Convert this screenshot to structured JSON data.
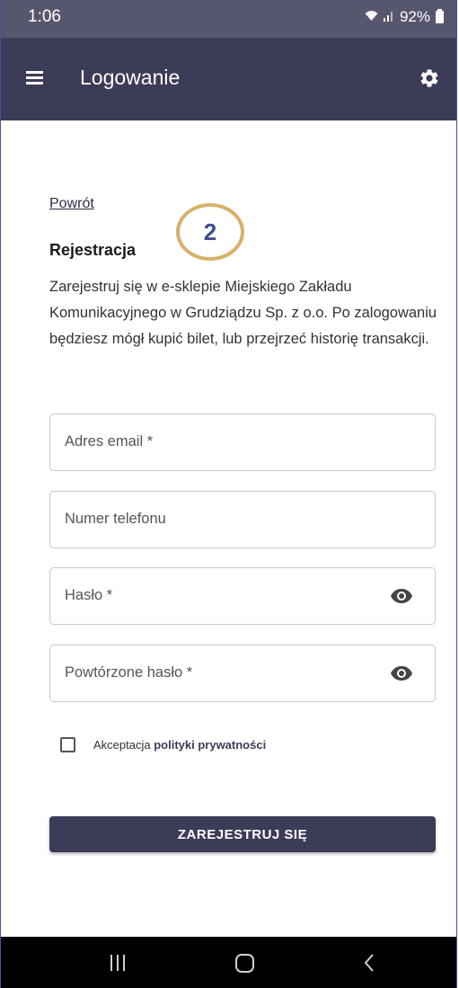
{
  "status_bar": {
    "time": "1:06",
    "battery": "92%"
  },
  "app_bar": {
    "title": "Logowanie"
  },
  "content": {
    "back_link": "Powrót",
    "step_number": "2",
    "section_title": "Rejestracja",
    "description": "Zarejestruj się w e-sklepie Miejskiego Zakładu Komunikacyjnego w Grudziądzu Sp. z o.o. Po zalogowaniu będziesz mógł kupić bilet, lub przejrzeć historię transakcji."
  },
  "form": {
    "email_placeholder": "Adres email *",
    "phone_placeholder": "Numer telefonu",
    "password_placeholder": "Hasło *",
    "password_repeat_placeholder": "Powtórzone hasło *",
    "consent_prefix": "Akceptacja",
    "consent_link": "polityki prywatności",
    "consent_checked": false,
    "submit_label": "ZAREJESTRUJ SIĘ"
  },
  "icons": [
    "menu-icon",
    "gear-icon",
    "eye-icon",
    "wifi-icon",
    "signal-icon",
    "battery-icon"
  ],
  "colors": {
    "app_bar": "#3c3c58",
    "status_bar": "#56566e",
    "button": "#3c3c58",
    "badge_border": "#d8b06c",
    "badge_text": "#3c4e8c"
  }
}
